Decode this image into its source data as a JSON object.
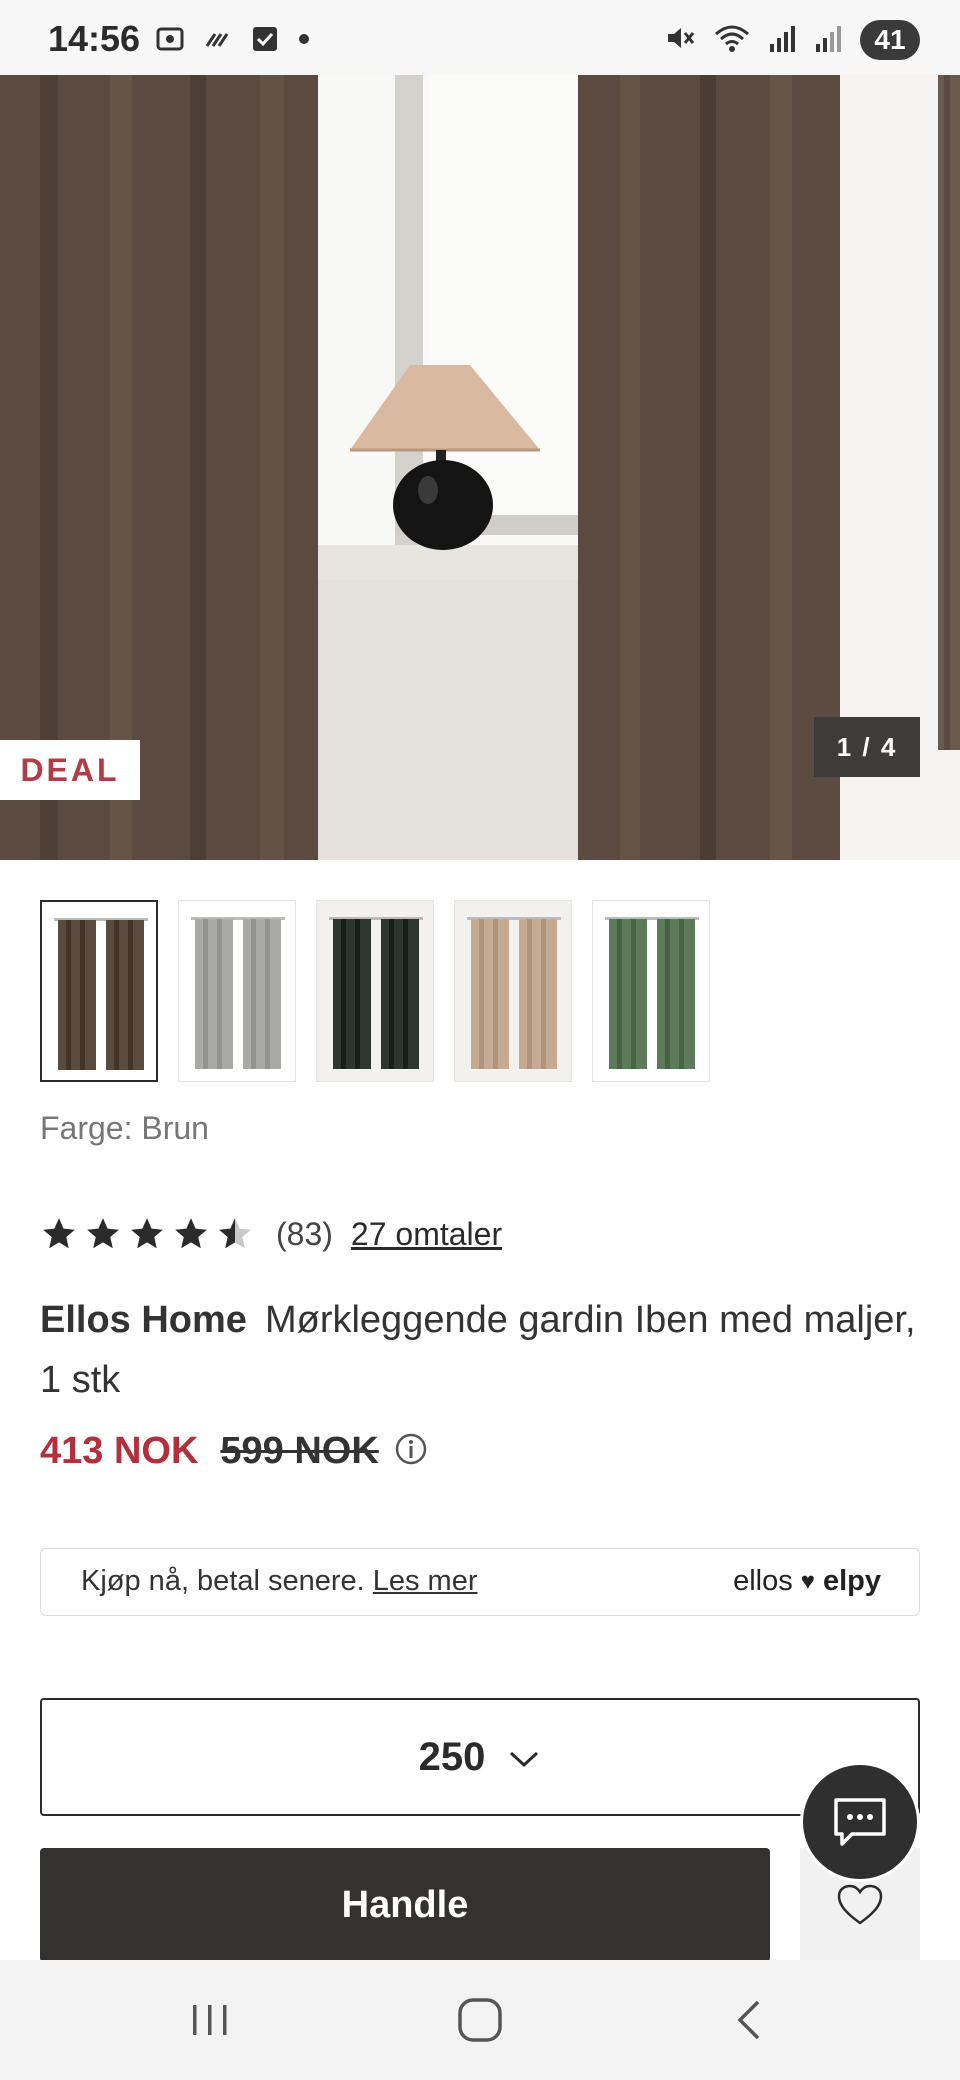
{
  "status_bar": {
    "time": "14:56",
    "battery": "41",
    "icons": [
      "screenshot-icon",
      "signal-sticker-icon",
      "checkbox-icon",
      "dot-icon",
      "mute-icon",
      "wifi-icon",
      "signal-icon",
      "signal-icon-2"
    ]
  },
  "gallery": {
    "badge": "DEAL",
    "counter": "1 / 4",
    "thumbnails": [
      {
        "color_name": "brown",
        "curtain_color": "#5b4a3e",
        "selected": true
      },
      {
        "color_name": "light-grey",
        "curtain_color": "#a9a9a7",
        "selected": false
      },
      {
        "color_name": "dark-green-black",
        "curtain_color": "#2f3530",
        "selected": false
      },
      {
        "color_name": "beige",
        "curtain_color": "#c4ab91",
        "selected": false
      },
      {
        "color_name": "green",
        "curtain_color": "#5d7a5b",
        "selected": false
      }
    ]
  },
  "product": {
    "color_label": "Farge: Brun",
    "rating_value": 4.5,
    "rating_count": "(83)",
    "reviews_link": "27 omtaler",
    "brand": "Ellos Home",
    "name": "Mørkleggende gardin Iben med maljer, 1 stk",
    "price_now": "413 NOK",
    "price_old": "599 NOK",
    "accent_color": "#b22f3b"
  },
  "bnpl": {
    "text": "Kjøp nå, betal senere.",
    "link": "Les mer",
    "logo_left": "ellos",
    "logo_right": "elpy"
  },
  "size_select": {
    "value": "250"
  },
  "actions": {
    "buy_label": "Handle"
  }
}
